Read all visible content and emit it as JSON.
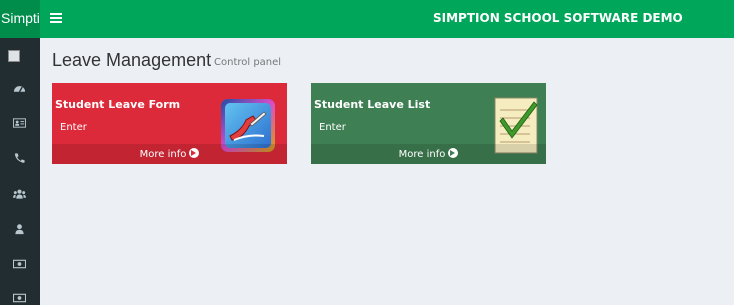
{
  "topbar": {
    "logo_text": "Simpti",
    "app_title": "SIMPTION SCHOOL SOFTWARE DEMO",
    "color": "#00a65a"
  },
  "sidebar": {
    "items": [
      {
        "icon": "dashboard-icon"
      },
      {
        "icon": "id-card-icon"
      },
      {
        "icon": "phone-icon"
      },
      {
        "icon": "users-icon"
      },
      {
        "icon": "user-icon"
      },
      {
        "icon": "money-icon"
      },
      {
        "icon": "money-icon"
      }
    ]
  },
  "page": {
    "title": "Leave Management",
    "subtitle": "Control panel"
  },
  "boxes": [
    {
      "title": "Student Leave Form",
      "enter": "Enter",
      "more": "More info",
      "color": "#dd2a3a",
      "icon": "leave-form-icon"
    },
    {
      "title": "Student Leave List",
      "enter": "Enter",
      "more": "More info",
      "color": "#3e7f53",
      "icon": "checklist-icon"
    }
  ]
}
